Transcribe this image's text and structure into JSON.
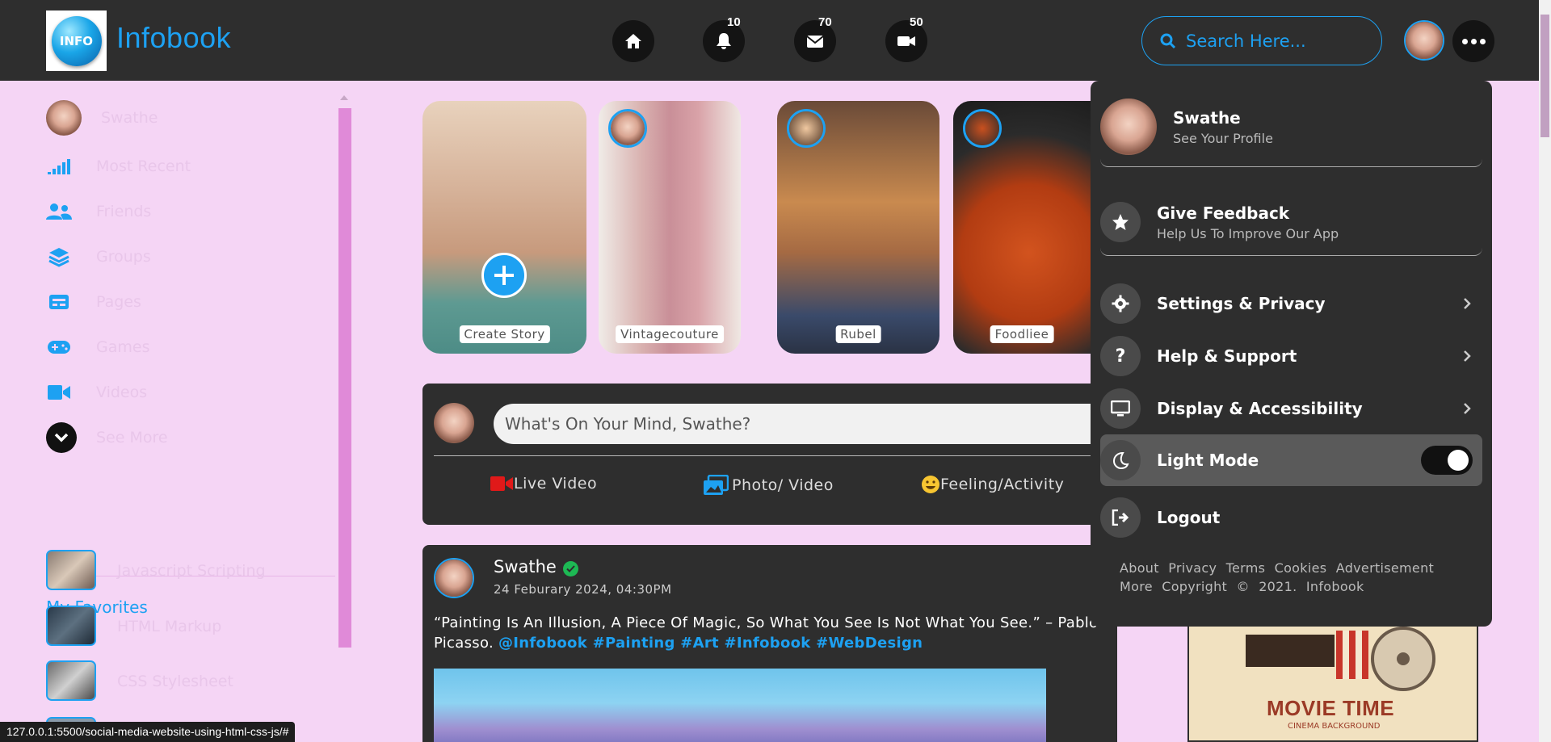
{
  "app": {
    "logo_text": "INFO",
    "brand": "Infobook"
  },
  "nav": {
    "notifications_count": "10",
    "messages_count": "70",
    "videos_count": "50",
    "search_placeholder": "Search Here..."
  },
  "sidebar": {
    "profile_name": "Swathe",
    "items": [
      {
        "label": "Most Recent",
        "icon": "bars-icon"
      },
      {
        "label": "Friends",
        "icon": "users-icon"
      },
      {
        "label": "Groups",
        "icon": "layers-icon"
      },
      {
        "label": "Pages",
        "icon": "page-icon"
      },
      {
        "label": "Games",
        "icon": "gamepad-icon"
      },
      {
        "label": "Videos",
        "icon": "video-icon"
      },
      {
        "label": "See More",
        "icon": "chevron-down-icon"
      }
    ],
    "favorites_title": "My Favorites",
    "favorites": [
      {
        "label": "Javascript Scripting"
      },
      {
        "label": "HTML Markup"
      },
      {
        "label": "CSS Stylesheet"
      }
    ]
  },
  "stories": [
    {
      "label": "Create Story"
    },
    {
      "label": "Vintagecouture"
    },
    {
      "label": "Rubel"
    },
    {
      "label": "Foodliee"
    }
  ],
  "composer": {
    "placeholder": "What's On Your Mind, Swathe?",
    "actions": [
      "Live Video",
      "Photo/ Video",
      "Feeling/Activity"
    ]
  },
  "post": {
    "author": "Swathe",
    "date": "24 Feburary 2024, 04:30PM",
    "text": "“Painting Is An Illusion, A Piece Of Magic, So What You See Is Not What You See.” – Pablo Picasso.",
    "tags": "@Infobook #Painting #Art #Infobook #WebDesign"
  },
  "dropdown": {
    "profile_name": "Swathe",
    "profile_sub": "See Your Profile",
    "feedback_title": "Give Feedback",
    "feedback_sub": "Help Us To Improve Our App",
    "menu": [
      {
        "label": "Settings & Privacy",
        "icon": "gear-icon"
      },
      {
        "label": "Help & Support",
        "icon": "question-icon"
      },
      {
        "label": "Display & Accessibility",
        "icon": "monitor-icon"
      }
    ],
    "light_mode": "Light Mode",
    "logout": "Logout",
    "footer": "About Privacy Terms Cookies Advertisement More Copyright © 2021. Infobook"
  },
  "ad": {
    "title": "MOVIE TIME",
    "subtitle": "CINEMA BACKGROUND"
  },
  "status_url": "127.0.0.1:5500/social-media-website-using-html-css-js/#",
  "colors": {
    "accent": "#1da1f2",
    "nav_bg": "#2e2e2e",
    "page_bg": "#f5d5f5"
  }
}
